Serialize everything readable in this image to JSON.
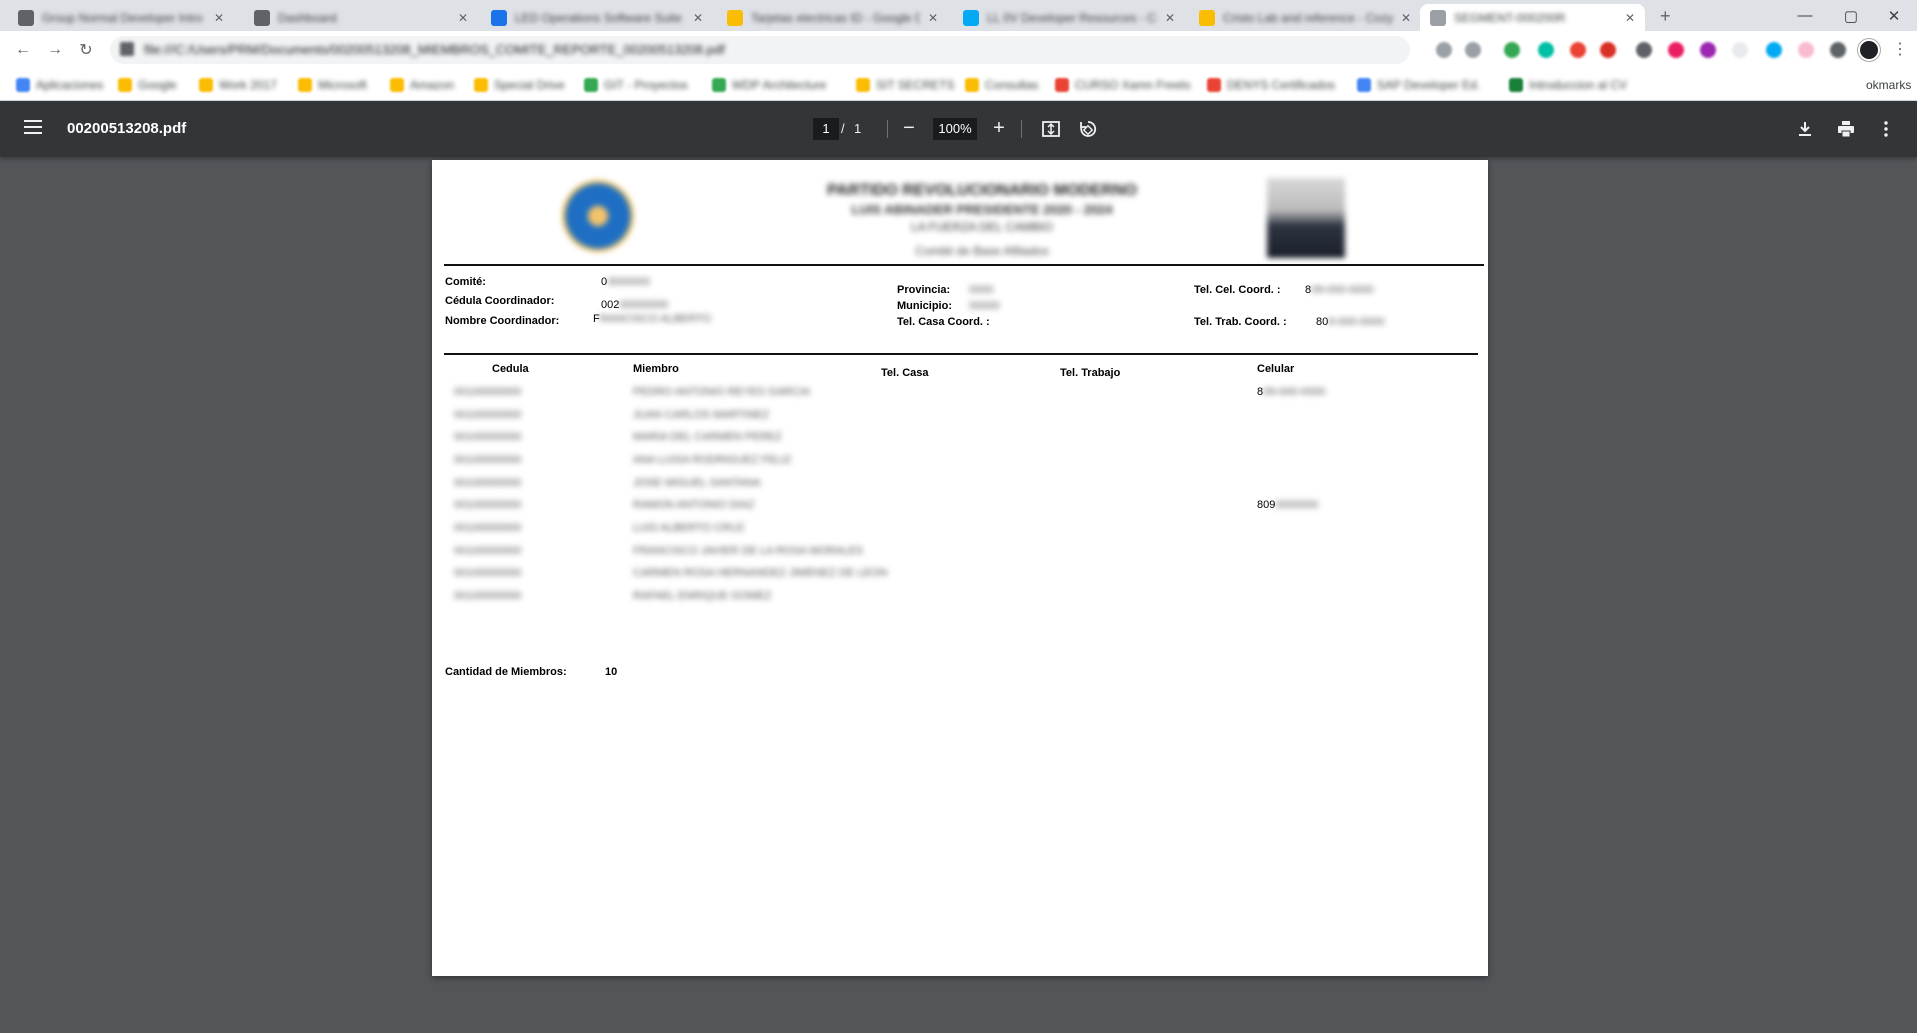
{
  "browser": {
    "tabs": [
      {
        "label": "Group Normal Developer Intro",
        "fav": "#5f6368",
        "active": false
      },
      {
        "label": "Dashboard",
        "fav": "#5f6368",
        "active": false
      },
      {
        "label": "LED Operations Software Suite",
        "fav": "#1a73e8",
        "active": false
      },
      {
        "label": "Tarjetas electricas ID - Google D",
        "fav": "#fbbc04",
        "active": false
      },
      {
        "label": "LL 0V Developer Resources - Co",
        "fav": "#03a9f4",
        "active": false
      },
      {
        "label": "Cristo Lab and reference - Cozy",
        "fav": "#fbbc04",
        "active": false
      },
      {
        "label": "SEGMENT-000200R",
        "fav": "#9aa0a6",
        "active": true
      }
    ],
    "window_controls": [
      "—",
      "▢",
      "✕"
    ],
    "url": "file:///C:/Users/PRM/Documents/00200513208_MIEMBROS_COMITE_REPORTE_00200513208.pdf",
    "bookmarks": [
      {
        "label": "Aplicaciones",
        "color": "#4285f4"
      },
      {
        "label": "Google",
        "color": "#fbbc04"
      },
      {
        "label": "Work 2017",
        "color": "#fbbc04"
      },
      {
        "label": "Microsoft",
        "color": "#fbbc04"
      },
      {
        "label": "Amazon",
        "color": "#fbbc04"
      },
      {
        "label": "Special Drive",
        "color": "#fbbc04"
      },
      {
        "label": "GIT - Proyectos",
        "color": "#34a853"
      },
      {
        "label": "WDP Architecture",
        "color": "#34a853"
      },
      {
        "label": "SIT SECRETS",
        "color": "#fbbc04"
      },
      {
        "label": "Consultas",
        "color": "#fbbc04"
      },
      {
        "label": "CURSO Xamn Freelo",
        "color": "#ea4335"
      },
      {
        "label": "DENYS Certificados",
        "color": "#ea4335"
      },
      {
        "label": "SAP Developer Ed.",
        "color": "#4285f4"
      },
      {
        "label": "Introduccion al CV",
        "color": "#188038"
      }
    ],
    "bookmarks_overflow_label": "okmarks"
  },
  "viewer": {
    "filename": "00200513208.pdf",
    "page_current": "1",
    "page_separator": "/",
    "page_total": "1",
    "zoom": "100%",
    "zoom_out": "−",
    "zoom_in": "+"
  },
  "document": {
    "header": {
      "title": "PARTIDO REVOLUCIONARIO MODERNO",
      "subtitle": "LUIS ABINADER PRESIDENTE 2020 - 2024",
      "subtitle2": "LA FUERZA DEL CAMBIO",
      "subtitle3": "Comité de Base Afiliados"
    },
    "comite_label": "Comité:",
    "comite_value": "0",
    "comite_mask": "3000000",
    "cedula_coord_label": "Cédula Coordinador:",
    "cedula_coord_value": "002",
    "cedula_coord_mask": "00000000",
    "nombre_coord_label": "Nombre Coordinador:",
    "nombre_coord_value": "F",
    "nombre_coord_mask": "RANCISCO ALBERTO",
    "provincia_label": "Provincia:",
    "provincia_mask": "0000",
    "municipio_label": "Municipio:",
    "municipio_mask": "00000",
    "tel_casa_coord_label": "Tel. Casa Coord. :",
    "tel_cel_coord_label": "Tel. Cel. Coord. :",
    "tel_cel_coord_value": "8",
    "tel_cel_coord_mask": "09-000-0000",
    "tel_trab_coord_label": "Tel. Trab. Coord. :",
    "tel_trab_coord_value": "80",
    "tel_trab_coord_mask": "9-000-0000",
    "columns": [
      "Cedula",
      "Miembro",
      "Tel. Casa",
      "Tel. Trabajo",
      "Celular"
    ],
    "rows": [
      {
        "cedula": "00100000000",
        "miembro": "PEDRO ANTONIO REYES GARCIA",
        "celular_prefix": "8",
        "celular_mask": "09-000-0000"
      },
      {
        "cedula": "00100000000",
        "miembro": "JUAN CARLOS MARTINEZ",
        "celular_prefix": "",
        "celular_mask": ""
      },
      {
        "cedula": "00100000000",
        "miembro": "MARIA DEL CARMEN PEREZ",
        "celular_prefix": "",
        "celular_mask": ""
      },
      {
        "cedula": "00100000000",
        "miembro": "ANA LUISA RODRIGUEZ FELIZ",
        "celular_prefix": "",
        "celular_mask": ""
      },
      {
        "cedula": "00100000000",
        "miembro": "JOSE MIGUEL SANTANA",
        "celular_prefix": "",
        "celular_mask": ""
      },
      {
        "cedula": "00100000000",
        "miembro": "RAMON ANTONIO DIAZ",
        "celular_prefix": "809",
        "celular_mask": "0000000"
      },
      {
        "cedula": "00100000000",
        "miembro": "LUIS ALBERTO CRUZ",
        "celular_prefix": "",
        "celular_mask": ""
      },
      {
        "cedula": "00100000000",
        "miembro": "FRANCISCO JAVIER DE LA ROSA MORALES",
        "celular_prefix": "",
        "celular_mask": ""
      },
      {
        "cedula": "00100000000",
        "miembro": "CARMEN ROSA HERNANDEZ JIMENEZ DE LEON",
        "celular_prefix": "",
        "celular_mask": ""
      },
      {
        "cedula": "00100000000",
        "miembro": "RAFAEL ENRIQUE GOMEZ",
        "celular_prefix": "",
        "celular_mask": ""
      }
    ],
    "cantidad_label": "Cantidad de Miembros:",
    "cantidad_value": "10"
  }
}
